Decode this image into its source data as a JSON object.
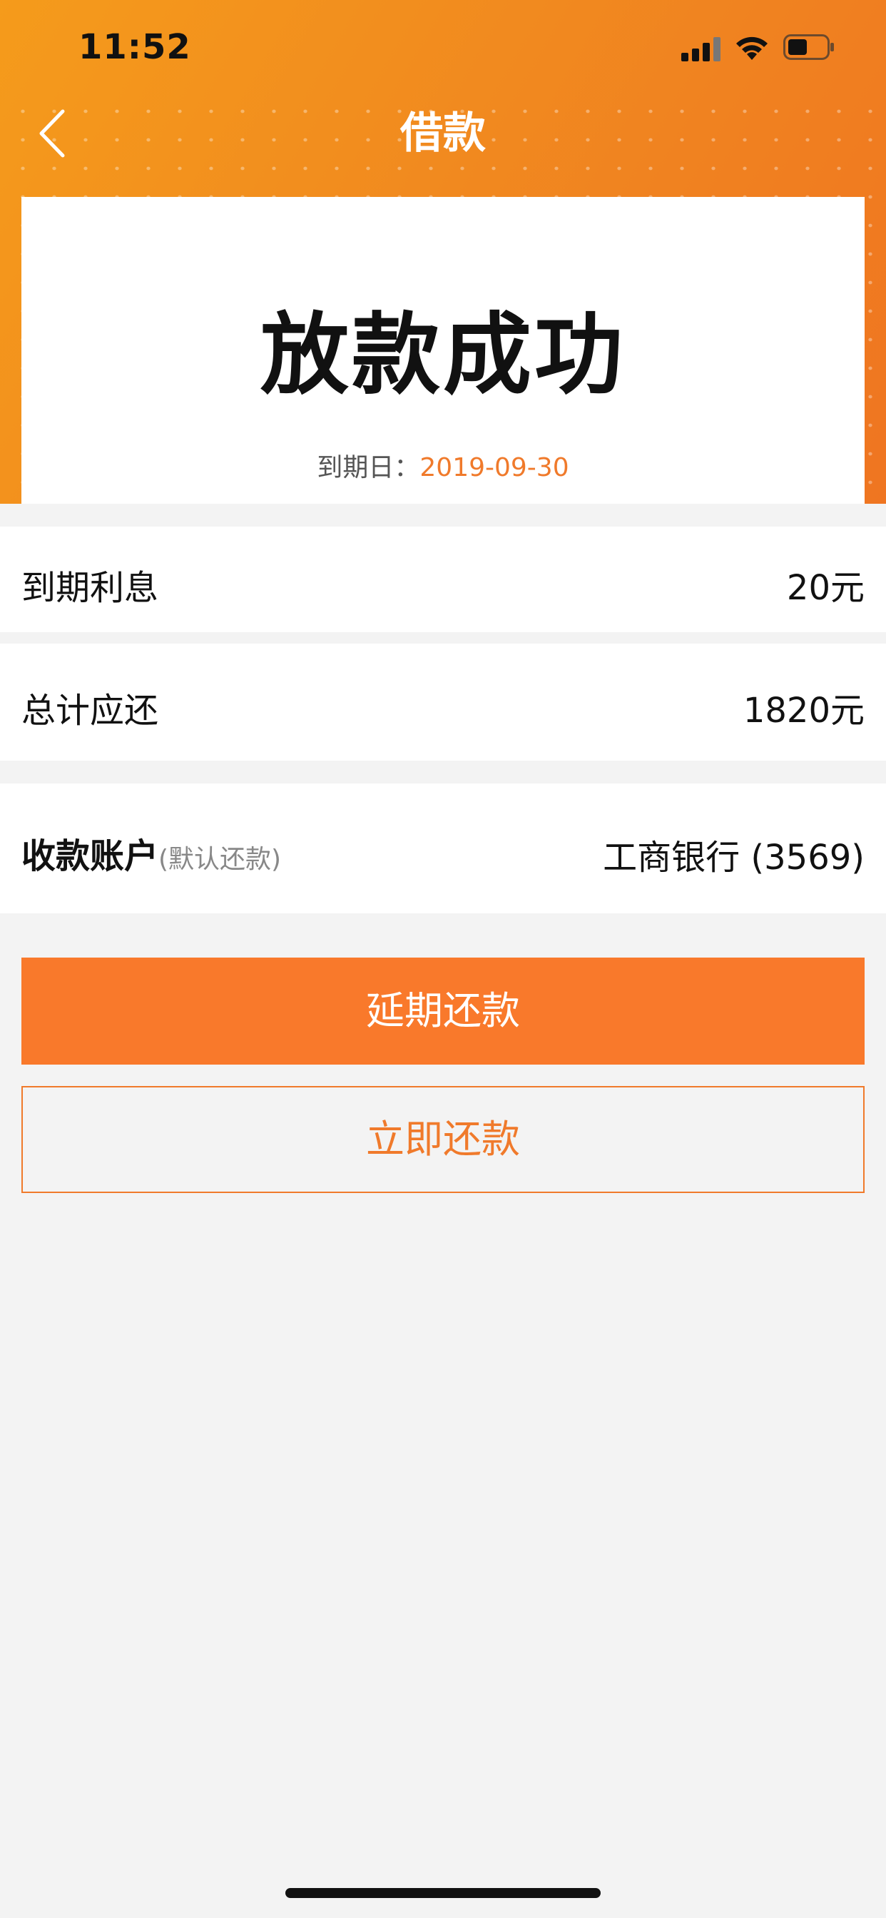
{
  "status_bar": {
    "time": "11:52",
    "icons": [
      "signal-icon",
      "wifi-icon",
      "battery-icon"
    ]
  },
  "nav": {
    "title": "借款",
    "back_icon": "chevron-left-icon"
  },
  "success_card": {
    "title": "放款成功",
    "due_label": "到期日：",
    "due_value": "2019-09-30"
  },
  "rows": {
    "interest": {
      "label": "到期利息",
      "value": "20元"
    },
    "total": {
      "label": "总计应还",
      "value": "1820元"
    },
    "account": {
      "label": "收款账户",
      "sub": "(默认还款)",
      "value": "工商银行 (3569)"
    }
  },
  "buttons": {
    "extend": "延期还款",
    "repay": "立即还款"
  },
  "colors": {
    "accent": "#f9792b",
    "header_start": "#f59b1b",
    "header_end": "#ef7521",
    "background": "#f3f3f3"
  }
}
